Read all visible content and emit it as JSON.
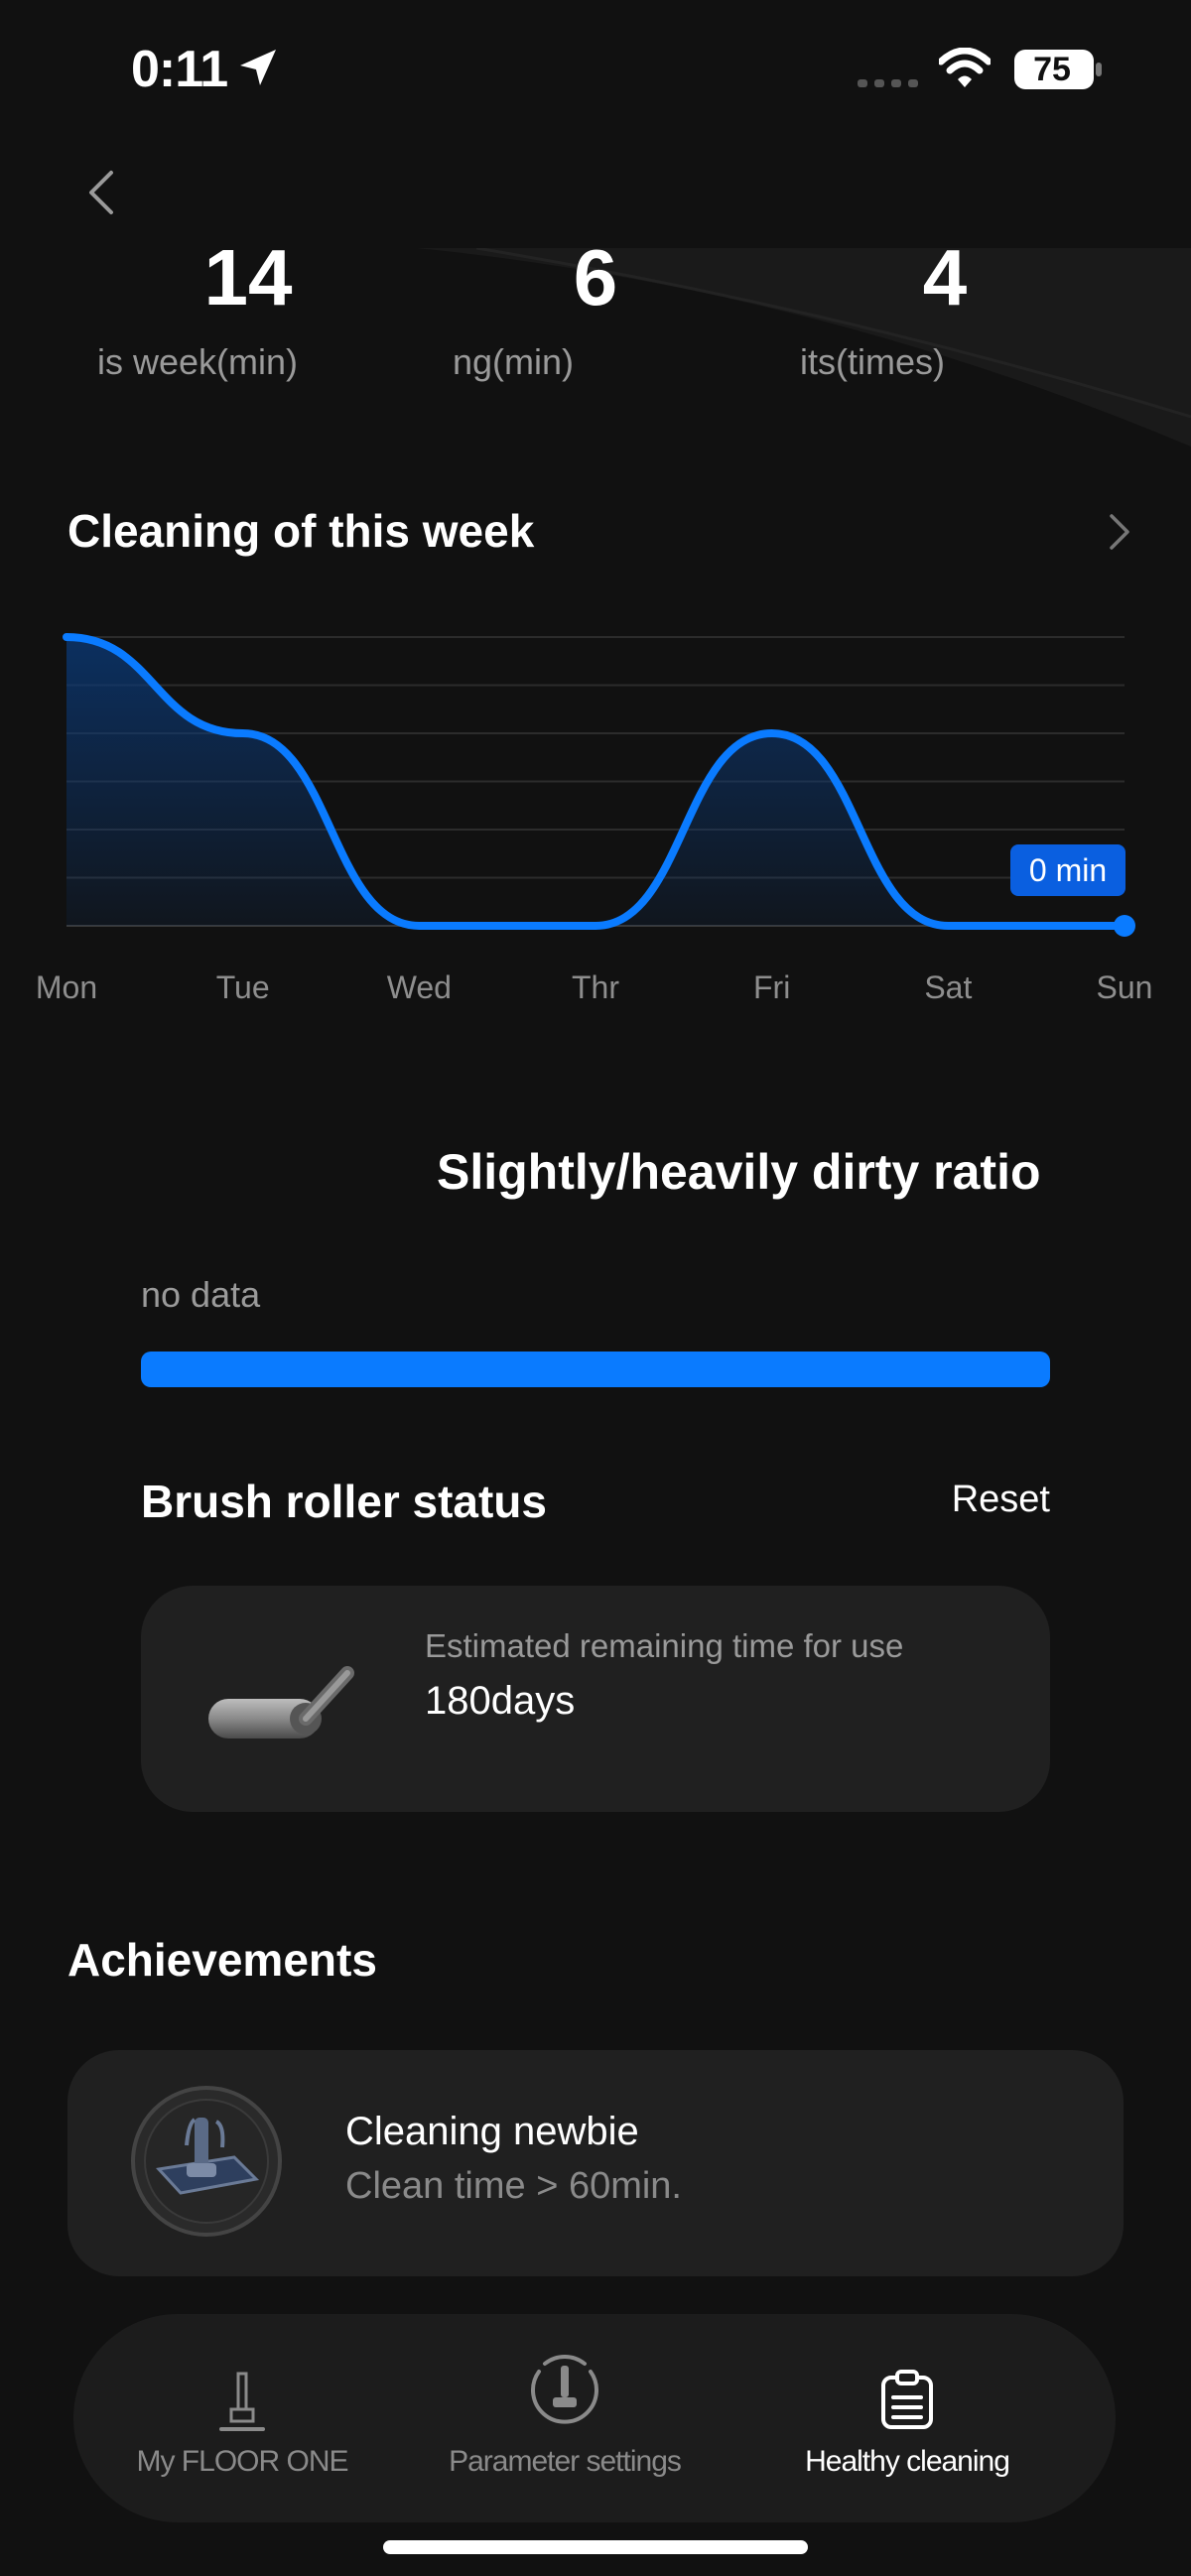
{
  "status_bar": {
    "time": "0:11",
    "battery": "75"
  },
  "stats": [
    {
      "value": "14",
      "label": "is week(min)"
    },
    {
      "value": "6",
      "label": "ng(min)"
    },
    {
      "value": "4",
      "label": "its(times)"
    }
  ],
  "week_chart": {
    "title": "Cleaning of this week",
    "tooltip": "0 min",
    "chart_data": {
      "type": "area",
      "title": "Cleaning of this week",
      "categories": [
        "Mon",
        "Tue",
        "Wed",
        "Thr",
        "Fri",
        "Sat",
        "Sun"
      ],
      "values": [
        6,
        4,
        0,
        0,
        4,
        0,
        0
      ],
      "ylim": [
        0,
        6
      ],
      "grid": true,
      "color": "#0a7bff"
    }
  },
  "dirty_ratio": {
    "title": "Slightly/heavily dirty ratio",
    "no_data": "no data",
    "bar_color": "#0a7bff"
  },
  "brush": {
    "title": "Brush roller status",
    "reset": "Reset",
    "est_label": "Estimated remaining time for use",
    "days": "180days",
    "icon": "brush-roller-icon"
  },
  "achievements": {
    "title": "Achievements",
    "name": "Cleaning newbie",
    "desc": "Clean time > 60min.",
    "icon": "achievement-badge-icon"
  },
  "nav": {
    "items": [
      {
        "label": "My FLOOR ONE",
        "icon": "vacuum-icon"
      },
      {
        "label": "Parameter settings",
        "icon": "settings-icon"
      },
      {
        "label": "Healthy cleaning",
        "icon": "clipboard-icon"
      }
    ]
  }
}
